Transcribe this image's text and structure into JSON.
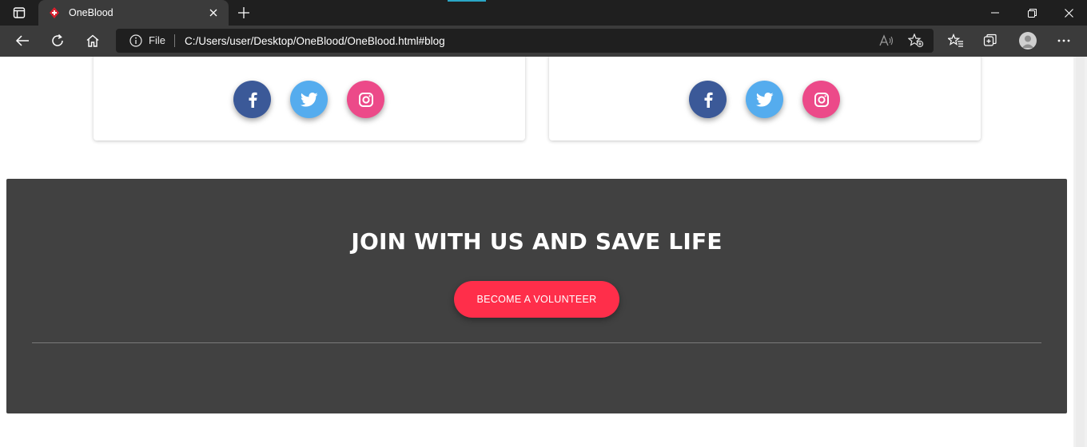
{
  "browser": {
    "tab": {
      "title": "OneBlood"
    },
    "address": {
      "scheme_label": "File",
      "url": "C:/Users/user/Desktop/OneBlood/OneBlood.html#blog"
    },
    "icons": [
      "tab-actions-icon",
      "favicon-blood-drop-icon",
      "close-tab-icon",
      "new-tab-icon",
      "minimize-icon",
      "restore-icon",
      "close-window-icon",
      "back-icon",
      "refresh-icon",
      "home-icon",
      "info-icon",
      "read-aloud-icon",
      "add-favorite-icon",
      "favorites-icon",
      "collections-icon",
      "profile-icon",
      "more-icon"
    ]
  },
  "cards": [
    {
      "social": [
        {
          "name": "facebook",
          "color": "#3b5998"
        },
        {
          "name": "twitter",
          "color": "#55acee"
        },
        {
          "name": "instagram",
          "color": "#ec4a89"
        }
      ]
    },
    {
      "social": [
        {
          "name": "facebook",
          "color": "#3b5998"
        },
        {
          "name": "twitter",
          "color": "#55acee"
        },
        {
          "name": "instagram",
          "color": "#ec4a89"
        }
      ]
    }
  ],
  "cta": {
    "heading": "JOIN WITH US AND SAVE LIFE",
    "button_label": "BECOME A VOLUNTEER",
    "background": "#414141",
    "button_color": "#ff2e4a"
  }
}
